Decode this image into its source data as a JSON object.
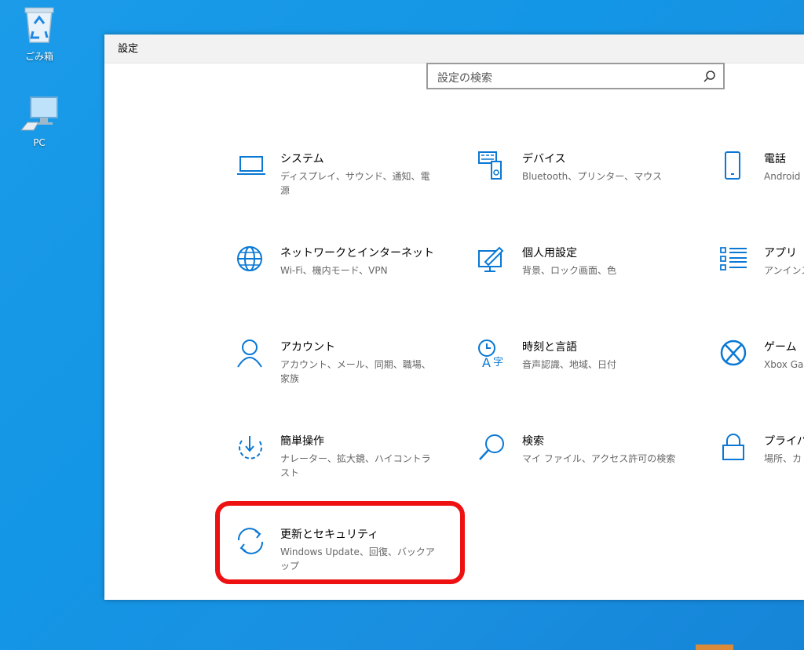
{
  "desktop": {
    "recycle_bin_label": "ごみ箱",
    "pc_label": "PC"
  },
  "window": {
    "title": "設定",
    "search_placeholder": "設定の検索"
  },
  "tiles": [
    {
      "name": "システム",
      "desc": "ディスプレイ、サウンド、通知、電源",
      "icon": "laptop-icon"
    },
    {
      "name": "デバイス",
      "desc": "Bluetooth、プリンター、マウス",
      "icon": "devices-icon"
    },
    {
      "name": "電話",
      "desc": "Android",
      "icon": "phone-icon"
    },
    {
      "name": "ネットワークとインターネット",
      "desc": "Wi-Fi、機内モード、VPN",
      "icon": "globe-icon"
    },
    {
      "name": "個人用設定",
      "desc": "背景、ロック画面、色",
      "icon": "personalization-icon"
    },
    {
      "name": "アプリ",
      "desc": "アンインス の機能",
      "icon": "apps-list-icon"
    },
    {
      "name": "アカウント",
      "desc": "アカウント、メール、同期、職場、家族",
      "icon": "person-icon"
    },
    {
      "name": "時刻と言語",
      "desc": "音声認識、地域、日付",
      "icon": "time-language-icon"
    },
    {
      "name": "ゲーム",
      "desc": "Xbox Ga 信、ゲーム",
      "icon": "xbox-icon"
    },
    {
      "name": "簡単操作",
      "desc": "ナレーター、拡大鏡、ハイコントラスト",
      "icon": "ease-of-access-icon"
    },
    {
      "name": "検索",
      "desc": "マイ ファイル、アクセス許可の検索",
      "icon": "search-icon"
    },
    {
      "name": "プライバシ",
      "desc": "場所、カ",
      "icon": "lock-icon"
    },
    {
      "name": "更新とセキュリティ",
      "desc": "Windows Update、回復、バックアップ",
      "icon": "sync-icon"
    }
  ],
  "colors": {
    "accent": "#0a78d4",
    "highlight": "#ee1111",
    "desktop": "#1496e6"
  }
}
